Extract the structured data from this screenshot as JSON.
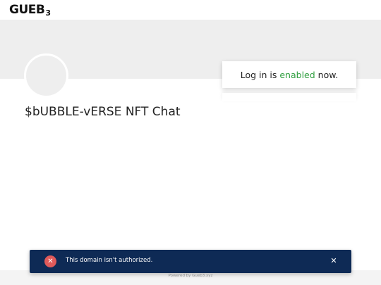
{
  "header": {
    "logo_text": "GUEB",
    "logo_sub": "3",
    "logo_icon": "gueb3-logo-icon"
  },
  "profile": {
    "chat_title": "$bUBBLE-vERSE NFT Chat"
  },
  "login_card": {
    "prefix": "Log in is",
    "status": "enabled",
    "suffix": "now.",
    "status_color": "#2e9e3e"
  },
  "toast": {
    "icon": "error-x-icon",
    "icon_glyph": "✕",
    "message": "This domain isn't authorized.",
    "close_glyph": "✕",
    "background": "#0e2a55",
    "icon_color": "#e05a5a"
  },
  "footer": {
    "powered_by": "Powered by Gueb3.xyz"
  }
}
